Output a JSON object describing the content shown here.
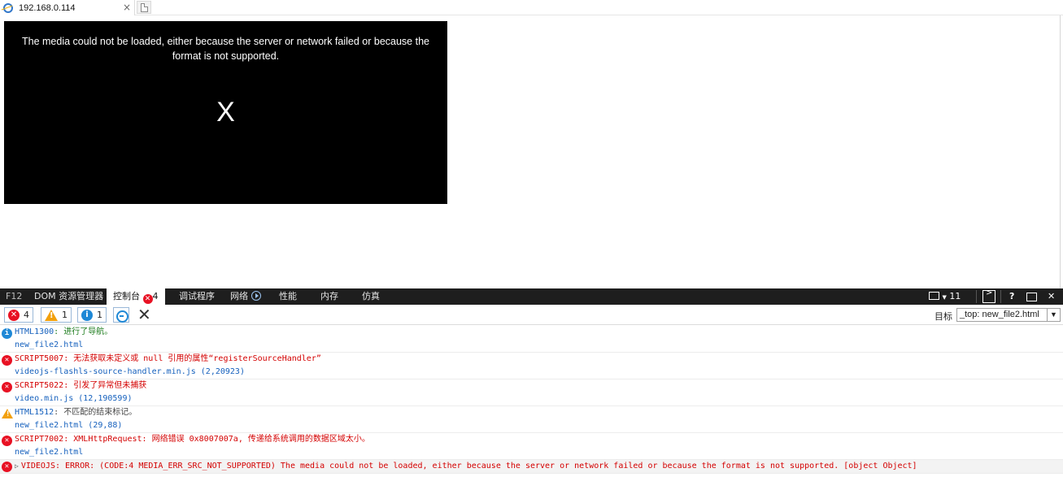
{
  "browser": {
    "tab_title": "192.168.0.114",
    "tab_close": "×"
  },
  "player": {
    "error_message": "The media could not be loaded, either because the server or network failed or because the format is not supported.",
    "close_glyph": "X",
    "background_color": "#000000"
  },
  "devtools": {
    "tabs": {
      "f12": "F12",
      "dom": "DOM 资源管理器",
      "console": "控制台",
      "console_badge": "4",
      "debugger": "调试程序",
      "network": "网络",
      "performance": "性能",
      "memory": "内存",
      "emulation": "仿真"
    },
    "right": {
      "doc_mode": "11",
      "help": "?",
      "close": "✕"
    },
    "toolbar": {
      "errors_count": "4",
      "warnings_count": "1",
      "messages_count": "1",
      "clear_glyph": "✕",
      "target_label": "目标",
      "target_value": "_top: new_file2.html"
    },
    "console": {
      "entries": [
        {
          "level": "info",
          "code": "HTML1300",
          "message": ": 进行了导航。",
          "source": "new_file2.html"
        },
        {
          "level": "error",
          "code": "SCRIPT5007",
          "message": ": 无法获取未定义或 null 引用的属性“registerSourceHandler”",
          "source": "videojs-flashls-source-handler.min.js (2,20923)"
        },
        {
          "level": "error",
          "code": "SCRIPT5022",
          "message": ": 引发了异常但未捕获",
          "source": "video.min.js (12,190599)"
        },
        {
          "level": "warning",
          "code": "HTML1512",
          "message": ": 不匹配的结束标记。",
          "source": "new_file2.html (29,88)"
        },
        {
          "level": "error",
          "code": "SCRIPT7002",
          "message": ": XMLHttpRequest: 网络错误 0x8007007a, 传递给系统调用的数据区域太小。",
          "source": "new_file2.html"
        },
        {
          "level": "error",
          "code": "",
          "message": "VIDEOJS: ERROR: (CODE:4 MEDIA_ERR_SRC_NOT_SUPPORTED) The media could not be loaded, either because the server or network failed or because the format is not supported. [object Object]",
          "source": ""
        }
      ]
    }
  }
}
